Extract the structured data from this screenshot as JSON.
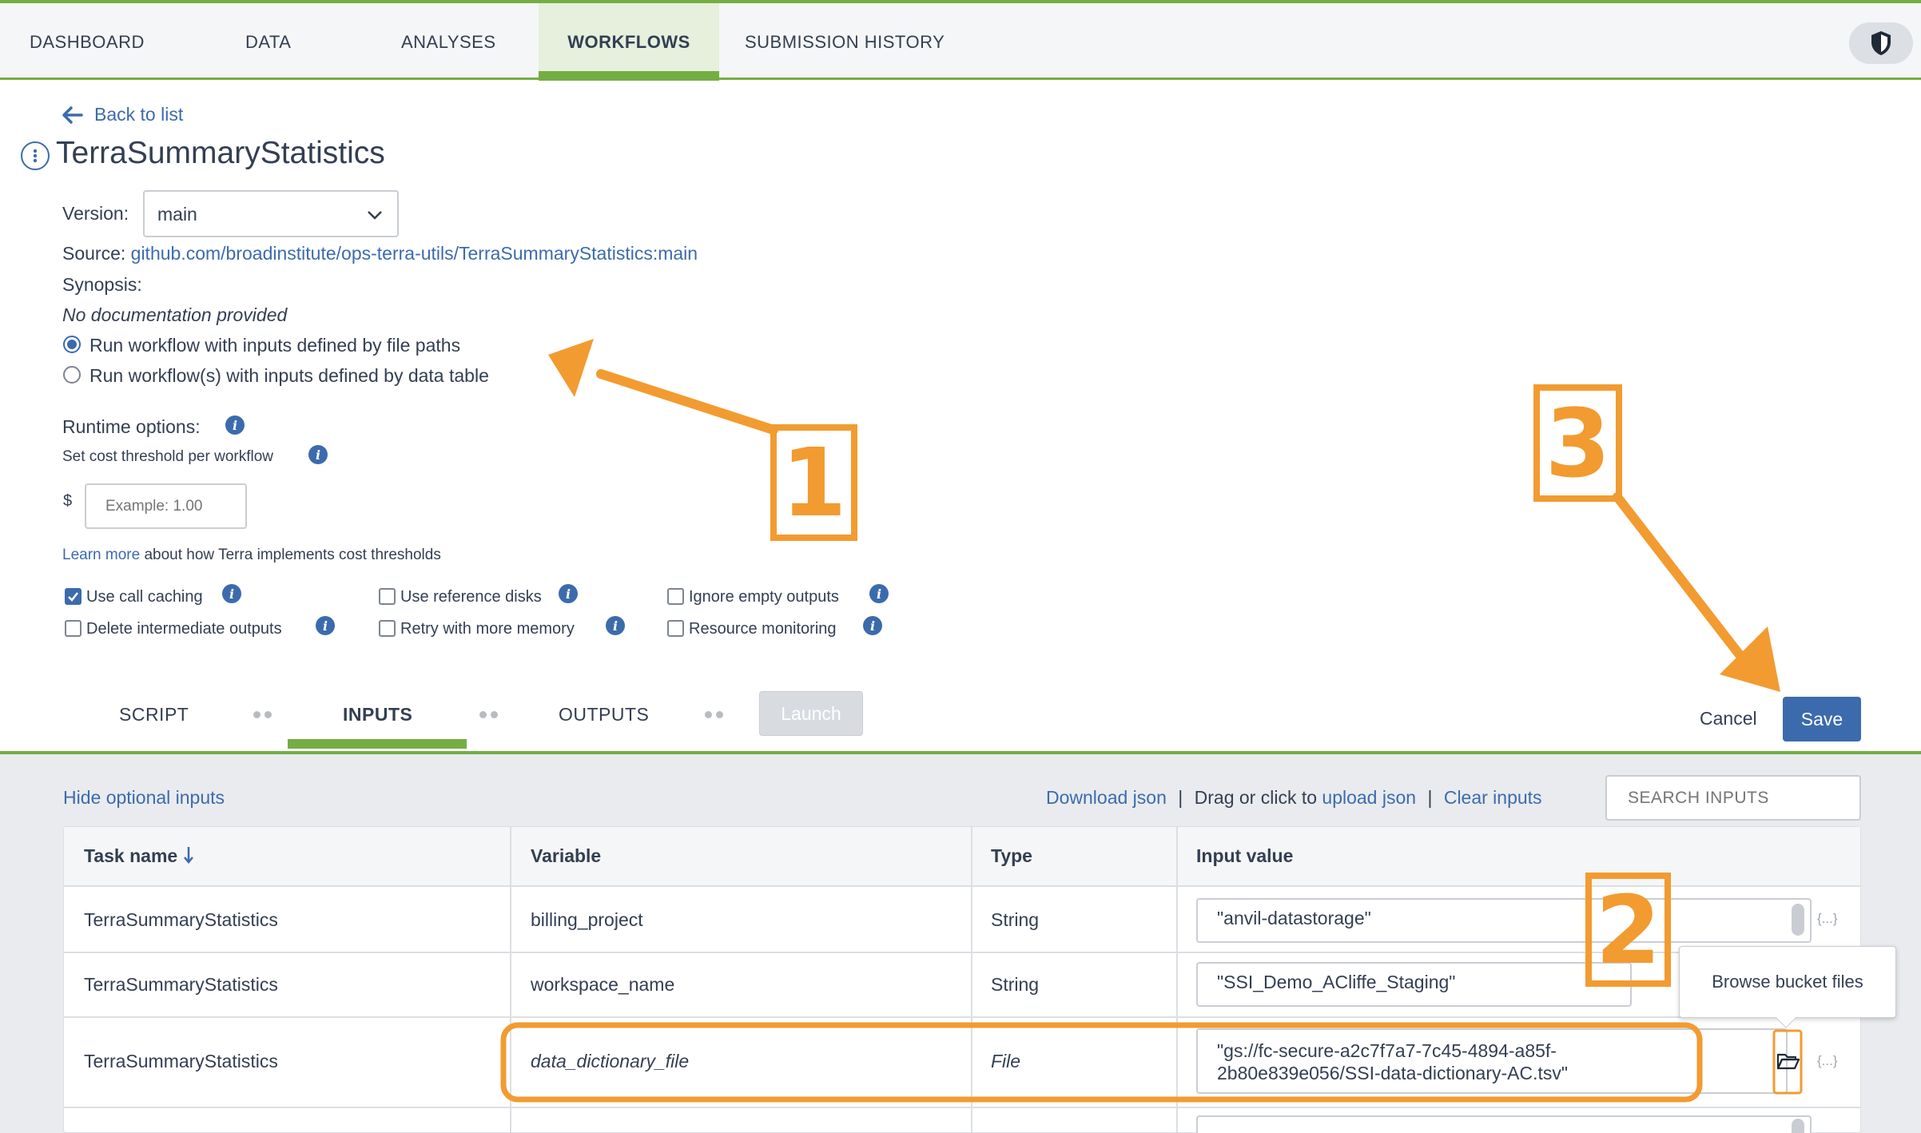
{
  "nav": {
    "tabs": [
      {
        "label": "DASHBOARD"
      },
      {
        "label": "DATA"
      },
      {
        "label": "ANALYSES"
      },
      {
        "label": "WORKFLOWS"
      },
      {
        "label": "SUBMISSION HISTORY"
      }
    ]
  },
  "header": {
    "back_label": "Back to list",
    "title": "TerraSummaryStatistics"
  },
  "config": {
    "version_label": "Version:",
    "version_value": "main",
    "source_label": "Source:",
    "source_link": "github.com/broadinstitute/ops-terra-utils/TerraSummaryStatistics:main",
    "synopsis_label": "Synopsis:",
    "synopsis_value": "No documentation provided",
    "radio_file_paths": "Run workflow with inputs defined by file paths",
    "radio_data_table": "Run workflow(s) with inputs defined by data table",
    "runtime_label": "Runtime options:",
    "cost_threshold_label": "Set cost threshold per workflow",
    "currency": "$",
    "cost_placeholder": "Example: 1.00",
    "learn_more_link": "Learn more",
    "learn_more_rest": "about how Terra implements cost thresholds"
  },
  "options": {
    "use_call_caching": "Use call caching",
    "delete_intermediate": "Delete intermediate outputs",
    "use_reference_disks": "Use reference disks",
    "retry_more_memory": "Retry with more memory",
    "ignore_empty_outputs": "Ignore empty outputs",
    "resource_monitoring": "Resource monitoring"
  },
  "subtabs": {
    "script": "SCRIPT",
    "inputs": "INPUTS",
    "outputs": "OUTPUTS",
    "launch": "Launch",
    "cancel": "Cancel",
    "save": "Save"
  },
  "inputs_panel": {
    "hide_optional": "Hide optional inputs",
    "download_json": "Download json",
    "sep1": "|",
    "drag_text": "Drag or click to",
    "upload_json": "upload json",
    "sep2": "|",
    "clear_inputs": "Clear inputs",
    "search_placeholder": "SEARCH INPUTS",
    "columns": {
      "task": "Task name",
      "variable": "Variable",
      "type": "Type",
      "value": "Input value"
    },
    "rows": [
      {
        "task": "TerraSummaryStatistics",
        "variable": "billing_project",
        "type": "String",
        "value": "\"anvil-datastorage\""
      },
      {
        "task": "TerraSummaryStatistics",
        "variable": "workspace_name",
        "type": "String",
        "value": "\"SSI_Demo_ACliffe_Staging\""
      },
      {
        "task": "TerraSummaryStatistics",
        "variable": "data_dictionary_file",
        "type": "File",
        "value_line1": "\"gs://fc-secure-a2c7f7a7-7c45-4894-a85f-",
        "value_line2": "2b80e839e056/SSI-data-dictionary-AC.tsv\""
      }
    ],
    "json_button": "{...}",
    "tooltip": "Browse bucket files"
  },
  "annotations": {
    "one": "1",
    "two": "2",
    "three": "3",
    "color": "#f29b31"
  },
  "colors": {
    "accent_green": "#74ae43",
    "link_blue": "#3c6bad"
  }
}
